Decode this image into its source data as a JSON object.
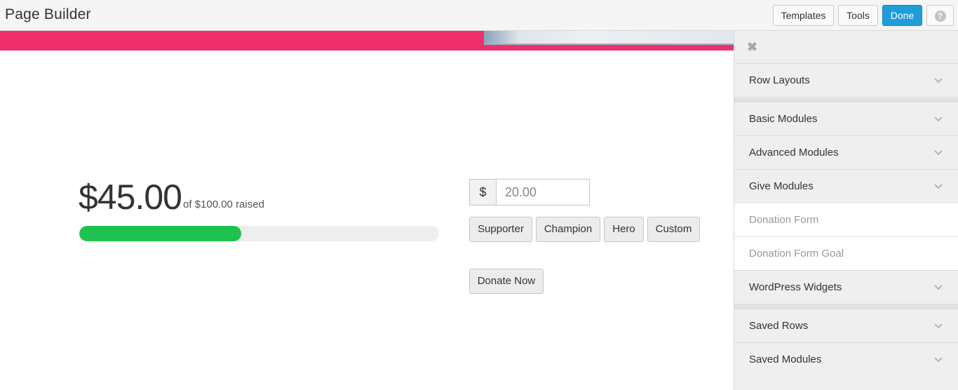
{
  "app": {
    "title": "Page Builder"
  },
  "toolbar": {
    "templates_label": "Templates",
    "tools_label": "Tools",
    "done_label": "Done",
    "help_glyph": "?"
  },
  "donation": {
    "raised": "$45.00",
    "goal_text": "of $100.00 raised",
    "progress_percent": 45,
    "currency_symbol": "$",
    "amount_value": "20.00",
    "levels": [
      "Supporter",
      "Champion",
      "Hero",
      "Custom"
    ],
    "donate_label": "Donate Now"
  },
  "panel": {
    "close_glyph": "✖",
    "sections": [
      {
        "label": "Row Layouts"
      },
      {
        "label": "Basic Modules"
      },
      {
        "label": "Advanced Modules"
      },
      {
        "label": "Give Modules"
      },
      {
        "label": "Donation Form"
      },
      {
        "label": "Donation Form Goal"
      },
      {
        "label": "WordPress Widgets"
      },
      {
        "label": "Saved Rows"
      },
      {
        "label": "Saved Modules"
      }
    ]
  },
  "colors": {
    "accent": "#1f9dd9",
    "banner": "#f0306c",
    "progress": "#1fc24f"
  }
}
